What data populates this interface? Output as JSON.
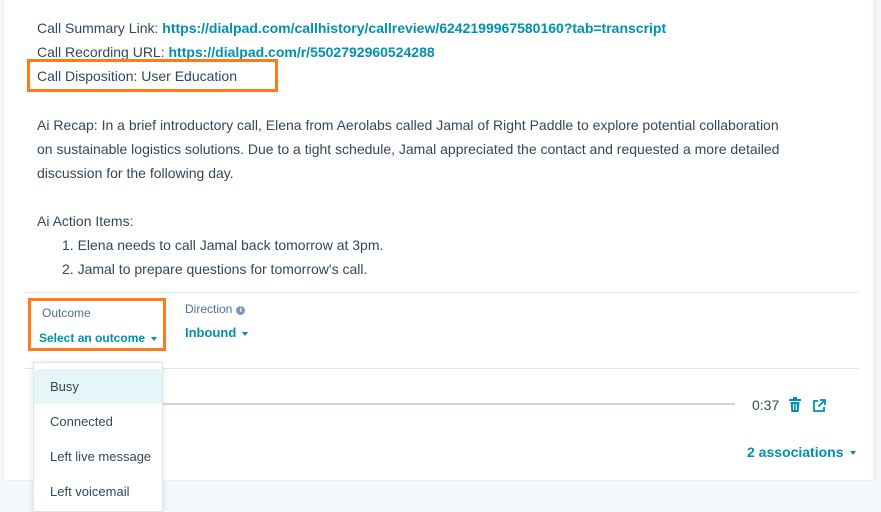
{
  "summary": {
    "call_summary_label": "Call Summary Link:",
    "call_summary_url": "https://dialpad.com/callhistory/callreview/6242199967580160?tab=transcript",
    "call_recording_label": "Call Recording URL:",
    "call_recording_url": "https://dialpad.com/r/5502792960524288",
    "call_disposition": "Call Disposition: User Education",
    "ai_recap_line1": "Ai Recap: In a brief introductory call, Elena from Aerolabs called Jamal of Right Paddle to explore potential collaboration",
    "ai_recap_line2": "on sustainable logistics solutions. Due to a tight schedule, Jamal appreciated the contact and requested a more detailed",
    "ai_recap_line3": "discussion for the following day.",
    "action_items_title": "Ai Action Items:",
    "action_items": [
      "1. Elena needs to call Jamal back tomorrow at 3pm.",
      "2. Jamal to prepare questions for tomorrow's call."
    ]
  },
  "fields": {
    "outcome_label": "Outcome",
    "outcome_value": "Select an outcome",
    "direction_label": "Direction",
    "direction_value": "Inbound"
  },
  "outcome_options": [
    "Busy",
    "Connected",
    "Left live message",
    "Left voicemail"
  ],
  "recording": {
    "duration": "0:37",
    "progress": 0
  },
  "associations": "2 associations",
  "colors": {
    "link": "#0091ae",
    "highlight": "#ff7a1a",
    "text": "#33475b",
    "selected_option_bg": "#e5f5f8"
  }
}
